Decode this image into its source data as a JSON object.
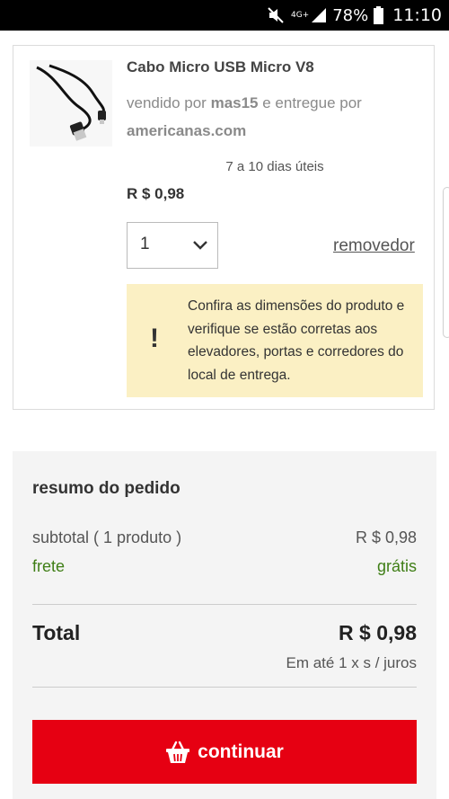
{
  "status_bar": {
    "network": "4G+",
    "battery": "78%",
    "time": "11:10"
  },
  "product": {
    "title": "Cabo Micro USB Micro V8",
    "sold_by_prefix": "vendido por",
    "seller": "mas15",
    "delivered_by_prefix": "e entregue por",
    "delivered_by": "americanas.com",
    "delivery_time": "7 a 10 dias úteis",
    "price": "R $ 0,98",
    "quantity": "1",
    "remove_label": "removedor",
    "warning_symbol": "!",
    "warning_text": "Confira as dimensões do produto e verifique se estão corretas aos elevadores, portas e corredores do local de entrega."
  },
  "summary": {
    "heading": "resumo do pedido",
    "subtotal_label": "subtotal ( 1 produto )",
    "subtotal_value": "R $ 0,98",
    "shipping_label": "frete",
    "shipping_value": "grátis",
    "total_label": "Total",
    "total_value": "R $ 0,98",
    "installments": "Em até 1 x s / juros",
    "continue_label": "continuar"
  },
  "colors": {
    "accent": "#e60012",
    "free_shipping": "#3f7e16",
    "warning_bg": "#fbf0c4"
  },
  "icons": [
    "mute-icon",
    "signal-icon",
    "battery-icon",
    "chevron-down-icon",
    "basket-icon"
  ]
}
